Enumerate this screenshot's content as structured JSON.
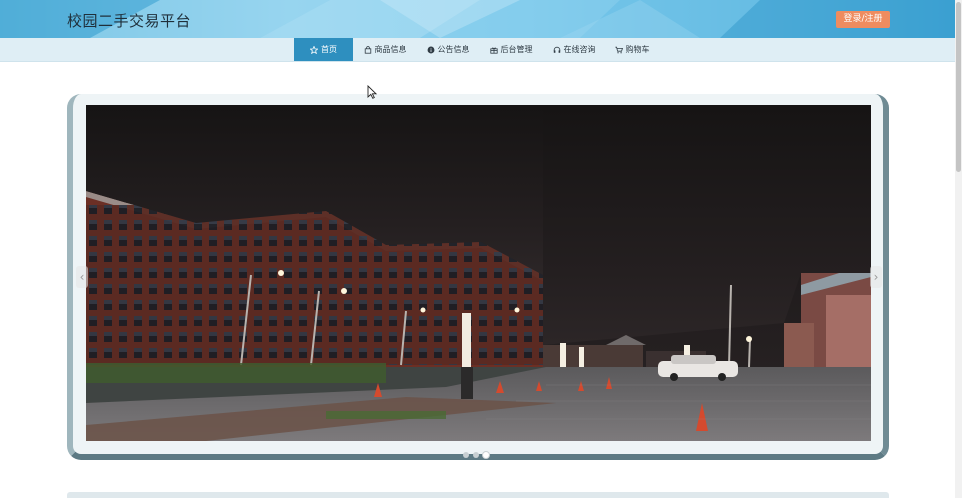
{
  "header": {
    "site_title": "校园二手交易平台",
    "login_label": "登录/注册"
  },
  "nav": {
    "items": [
      {
        "label": "首页",
        "icon": "star-icon",
        "active": true
      },
      {
        "label": "商品信息",
        "icon": "bag-icon"
      },
      {
        "label": "公告信息",
        "icon": "info-icon"
      },
      {
        "label": "后台管理",
        "icon": "gift-icon"
      },
      {
        "label": "在线咨询",
        "icon": "headset-icon"
      },
      {
        "label": "购物车",
        "icon": "cart-icon"
      }
    ]
  },
  "carousel": {
    "slide_count": 3,
    "active_index": 2,
    "prev_symbol": "‹",
    "next_symbol": "›"
  },
  "colors": {
    "accent": "#2e8fbf",
    "login_button": "#ef8c5f",
    "nav_bg": "#dfeef5"
  }
}
